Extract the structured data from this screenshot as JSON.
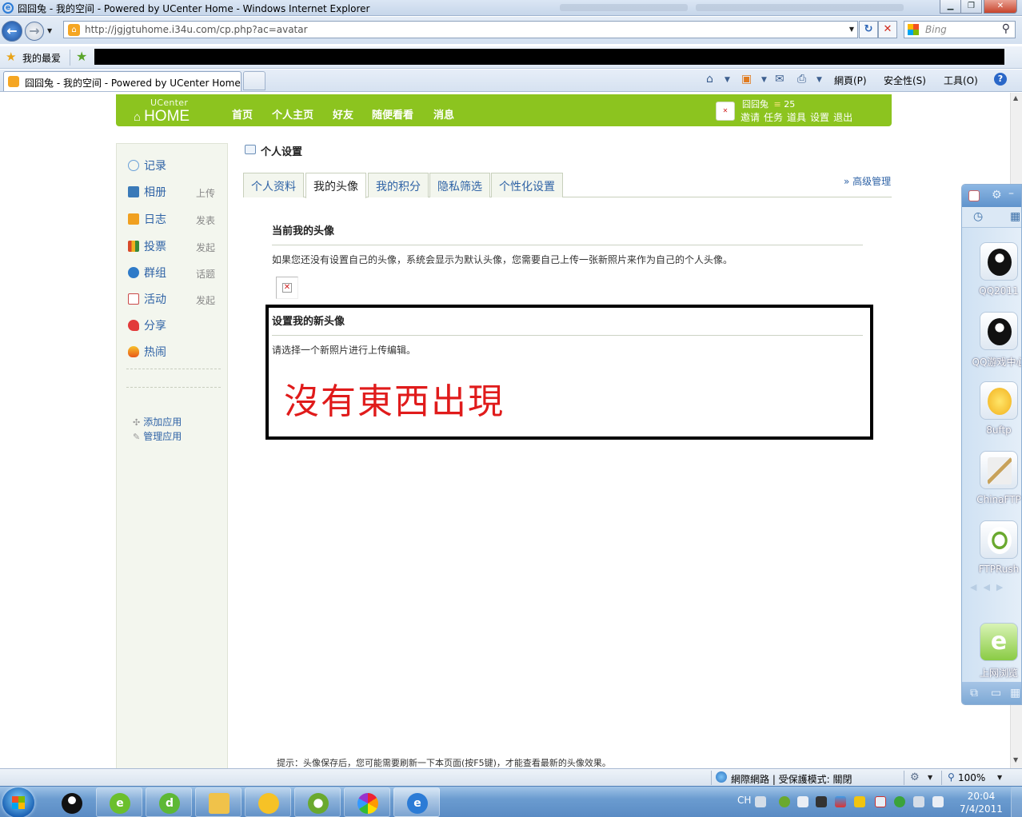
{
  "window": {
    "title": "囧囧兔 - 我的空间 - Powered by UCenter Home - Windows Internet Explorer"
  },
  "browser": {
    "url": "http://jgjgtuhome.i34u.com/cp.php?ac=avatar",
    "search_placeholder": "Bing",
    "favorites_label": "我的最爱",
    "tab_title": "囧囧兔 - 我的空间 - Powered by UCenter Home",
    "commands": {
      "page": "網頁(P)",
      "safety": "安全性(S)",
      "tools": "工具(O)"
    },
    "status": {
      "zone": "網際網路 | 受保護模式: 關閉",
      "zoom": "100%"
    }
  },
  "site": {
    "logo_top": "UCenter",
    "logo_main": "HOME",
    "nav": [
      "首页",
      "个人主页",
      "好友",
      "随便看看",
      "消息"
    ],
    "user": {
      "name": "囧囧兔",
      "credits": "25",
      "links": [
        "邀请",
        "任务",
        "道具",
        "设置",
        "退出"
      ]
    }
  },
  "sidebar": {
    "items": [
      {
        "label": "记录",
        "action": "",
        "icon": "record-icon",
        "color": "#6aa0d8"
      },
      {
        "label": "相册",
        "action": "上传",
        "icon": "album-icon",
        "color": "#3a7ab8"
      },
      {
        "label": "日志",
        "action": "发表",
        "icon": "blog-icon",
        "color": "#f0a020"
      },
      {
        "label": "投票",
        "action": "发起",
        "icon": "poll-icon",
        "color": "#d84a2a"
      },
      {
        "label": "群组",
        "action": "话题",
        "icon": "group-icon",
        "color": "#2f7bc8"
      },
      {
        "label": "活动",
        "action": "发起",
        "icon": "event-icon",
        "color": "#c94848"
      },
      {
        "label": "分享",
        "action": "",
        "icon": "share-icon",
        "color": "#e23a3a"
      },
      {
        "label": "热闹",
        "action": "",
        "icon": "fire-icon",
        "color": "#e8581a"
      }
    ],
    "apps": [
      "添加应用",
      "管理应用"
    ]
  },
  "main": {
    "page_title": "个人设置",
    "tabs": [
      "个人资料",
      "我的头像",
      "我的积分",
      "隐私筛选",
      "个性化设置"
    ],
    "active_tab": "我的头像",
    "advanced_link": "» 高级管理",
    "current_avatar": {
      "title": "当前我的头像",
      "desc": "如果您还没有设置自己的头像，系统会显示为默认头像，您需要自己上传一张新照片来作为自己的个人头像。"
    },
    "new_avatar": {
      "title": "设置我的新头像",
      "desc": "请选择一个新照片进行上传编辑。"
    },
    "annotation": "沒有東西出現",
    "tip": "提示：头像保存后，您可能需要刷新一下本页面(按F5键)，才能查看最新的头像效果。"
  },
  "qq_widget": {
    "apps": [
      "QQ2011",
      "QQ游戏中心",
      "8uftp",
      "ChinaFTP",
      "FTPRush",
      "上网浏览"
    ]
  },
  "taskbar": {
    "lang": "CH",
    "time": "20:04",
    "date": "7/4/2011"
  }
}
